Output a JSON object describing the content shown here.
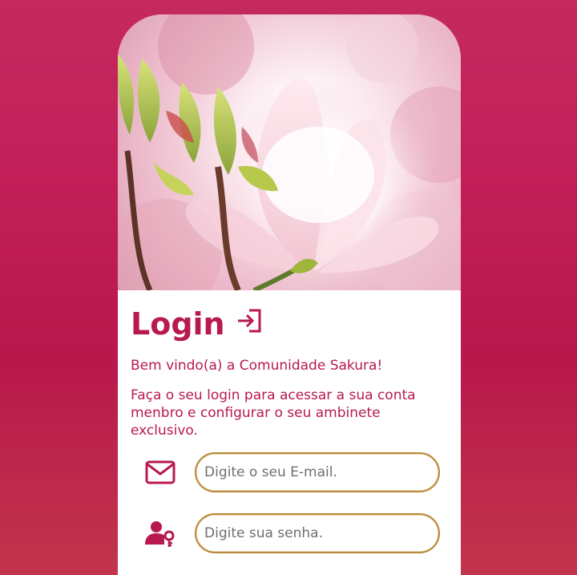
{
  "login": {
    "title": "Login",
    "welcome": "Bem vindo(a) a Comunidade Sakura!",
    "description": "Faça o seu login para acessar a sua conta menbro e configurar o seu ambinete exclusivo."
  },
  "form": {
    "email_placeholder": "Digite o seu E-mail.",
    "password_placeholder": "Digite sua senha."
  },
  "icons": {
    "login": "login-arrow-icon",
    "email": "mail-icon",
    "password": "user-key-icon",
    "hero": "magnolia-blossom-image"
  },
  "colors": {
    "accent": "#b8194f",
    "field_border": "#b98a3c",
    "background": "#c21f58"
  }
}
